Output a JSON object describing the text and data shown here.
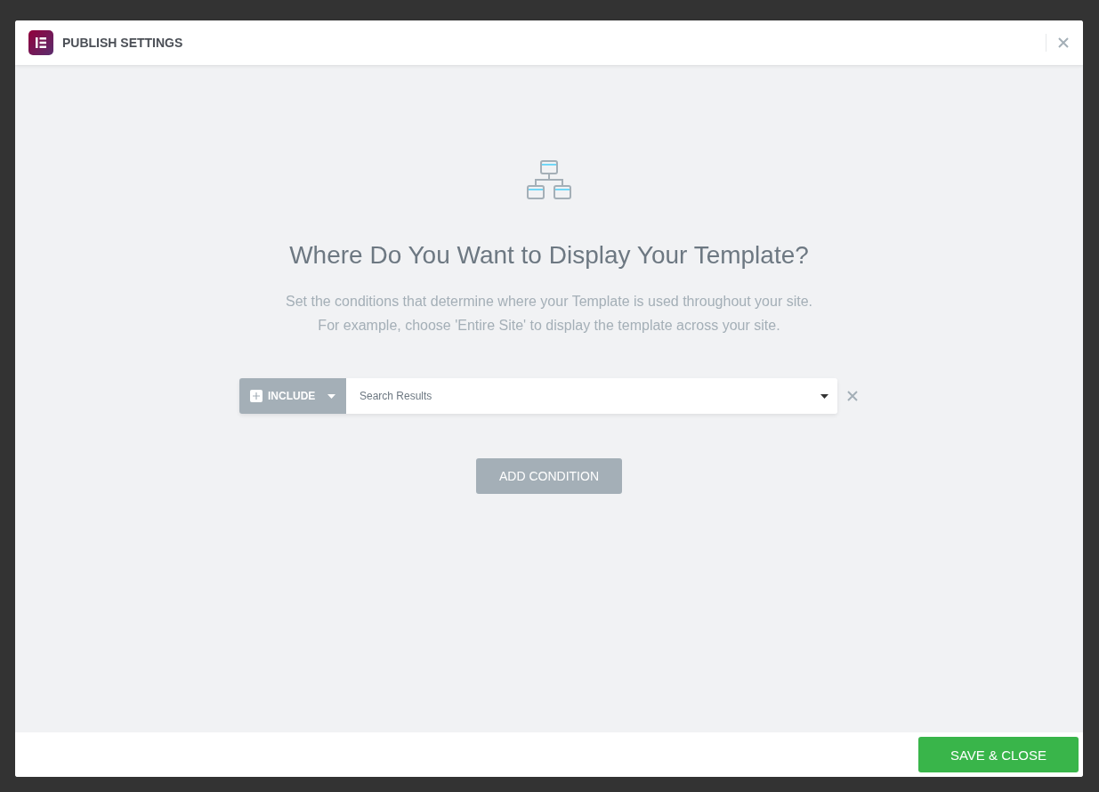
{
  "dialog": {
    "title": "PUBLISH SETTINGS"
  },
  "heading": "Where Do You Want to Display Your Template?",
  "description": [
    "Set the conditions that determine where your Template is used throughout your site.",
    "For example, choose 'Entire Site' to display the template across your site."
  ],
  "conditions": [
    {
      "type": "INCLUDE",
      "value": "Search Results"
    }
  ],
  "add_button": "ADD CONDITION",
  "save_button": "SAVE & CLOSE"
}
